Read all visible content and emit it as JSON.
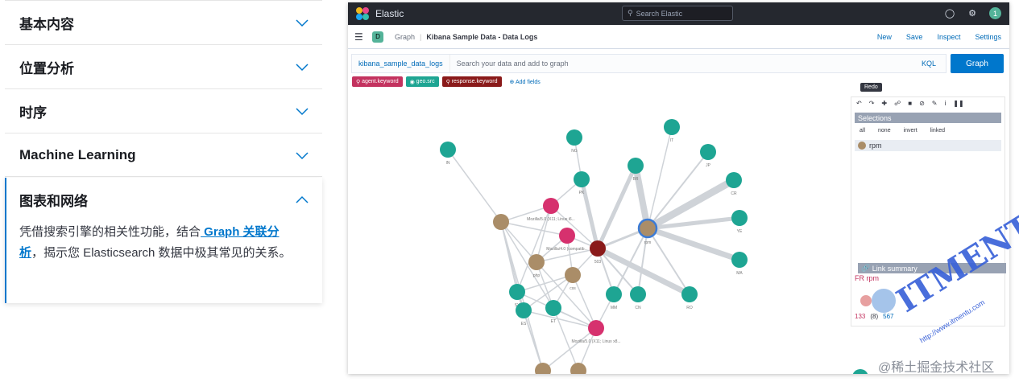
{
  "accordion": {
    "items": [
      {
        "title": "基本内容"
      },
      {
        "title": "位置分析"
      },
      {
        "title": "时序"
      },
      {
        "title": "Machine Learning"
      }
    ],
    "open": {
      "title": "图表和网络",
      "text_before": "凭借搜索引擎的相关性功能，结合",
      "link": " Graph 关联分析",
      "text_after": "，揭示您 Elasticsearch 数据中极其常见的关系。"
    }
  },
  "kibana": {
    "brand": "Elastic",
    "search_placeholder": "Search Elastic",
    "avatar": "1",
    "space": "D",
    "breadcrumbs": [
      "Graph",
      "Kibana Sample Data - Data Logs"
    ],
    "nav_links": [
      "New",
      "Save",
      "Inspect",
      "Settings"
    ],
    "query": {
      "index": "kibana_sample_data_logs",
      "placeholder": "Search your data and add to graph",
      "language": "KQL",
      "button": "Graph"
    },
    "fields": [
      {
        "label": "agent.keyword",
        "color": "#c3325f"
      },
      {
        "label": "geo.src",
        "color": "#1ea593"
      },
      {
        "label": "response.keyword",
        "color": "#8a1a1a"
      }
    ],
    "add_fields": "Add fields",
    "tooltip": "Redo",
    "selections": {
      "title": "Selections",
      "actions": [
        "all",
        "none",
        "invert",
        "linked"
      ],
      "item": "rpm"
    },
    "link_summary": {
      "title": "Link summary",
      "pair": "FR rpm",
      "counts": [
        "133",
        "(8)",
        "567"
      ]
    },
    "colors": {
      "geo": "#1ea593",
      "agent": "#d6316e",
      "response": "#8a1a1a",
      "ip": "#aa8d68"
    }
  },
  "watermarks": {
    "juejin": "@稀土掘金技术社区",
    "itmentu": "ITMENTU",
    "itmentu_url": "http://www.itmentu.com"
  }
}
